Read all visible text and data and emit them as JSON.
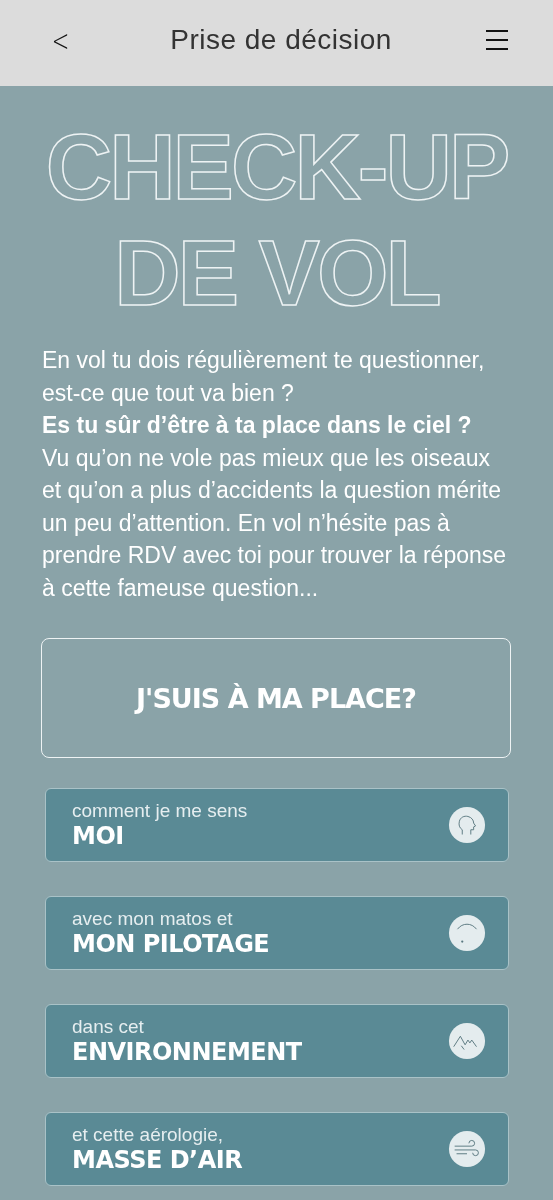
{
  "header": {
    "back": "<",
    "title": "Prise de décision"
  },
  "hero_title": [
    "CHECK-UP",
    "DE VOL"
  ],
  "intro": "En vol tu dois régulièrement te questionner, est-ce que tout va bien ?\n**Es tu sûr d’être à ta place dans le ciel ?**\nVu qu’on ne vole pas mieux que les oiseaux et qu’on a plus d’accidents la question mérite un peu d’attention. En vol n’hésite pas à prendre RDV avec toi pour trouver la réponse à cette fameuse question...",
  "main_button": "J'SUIS À MA PLACE?",
  "categories": [
    {
      "subtitle": "comment je me sens",
      "title": "MOI",
      "kind": "head"
    },
    {
      "subtitle": "avec mon matos et",
      "title": "MON PILOTAGE",
      "kind": "glider"
    },
    {
      "subtitle": "dans cet",
      "title": "ENVIRONNEMENT",
      "kind": "mountain"
    },
    {
      "subtitle": "et cette aérologie,",
      "title": "MASSE D’AIR",
      "kind": "wind"
    }
  ]
}
